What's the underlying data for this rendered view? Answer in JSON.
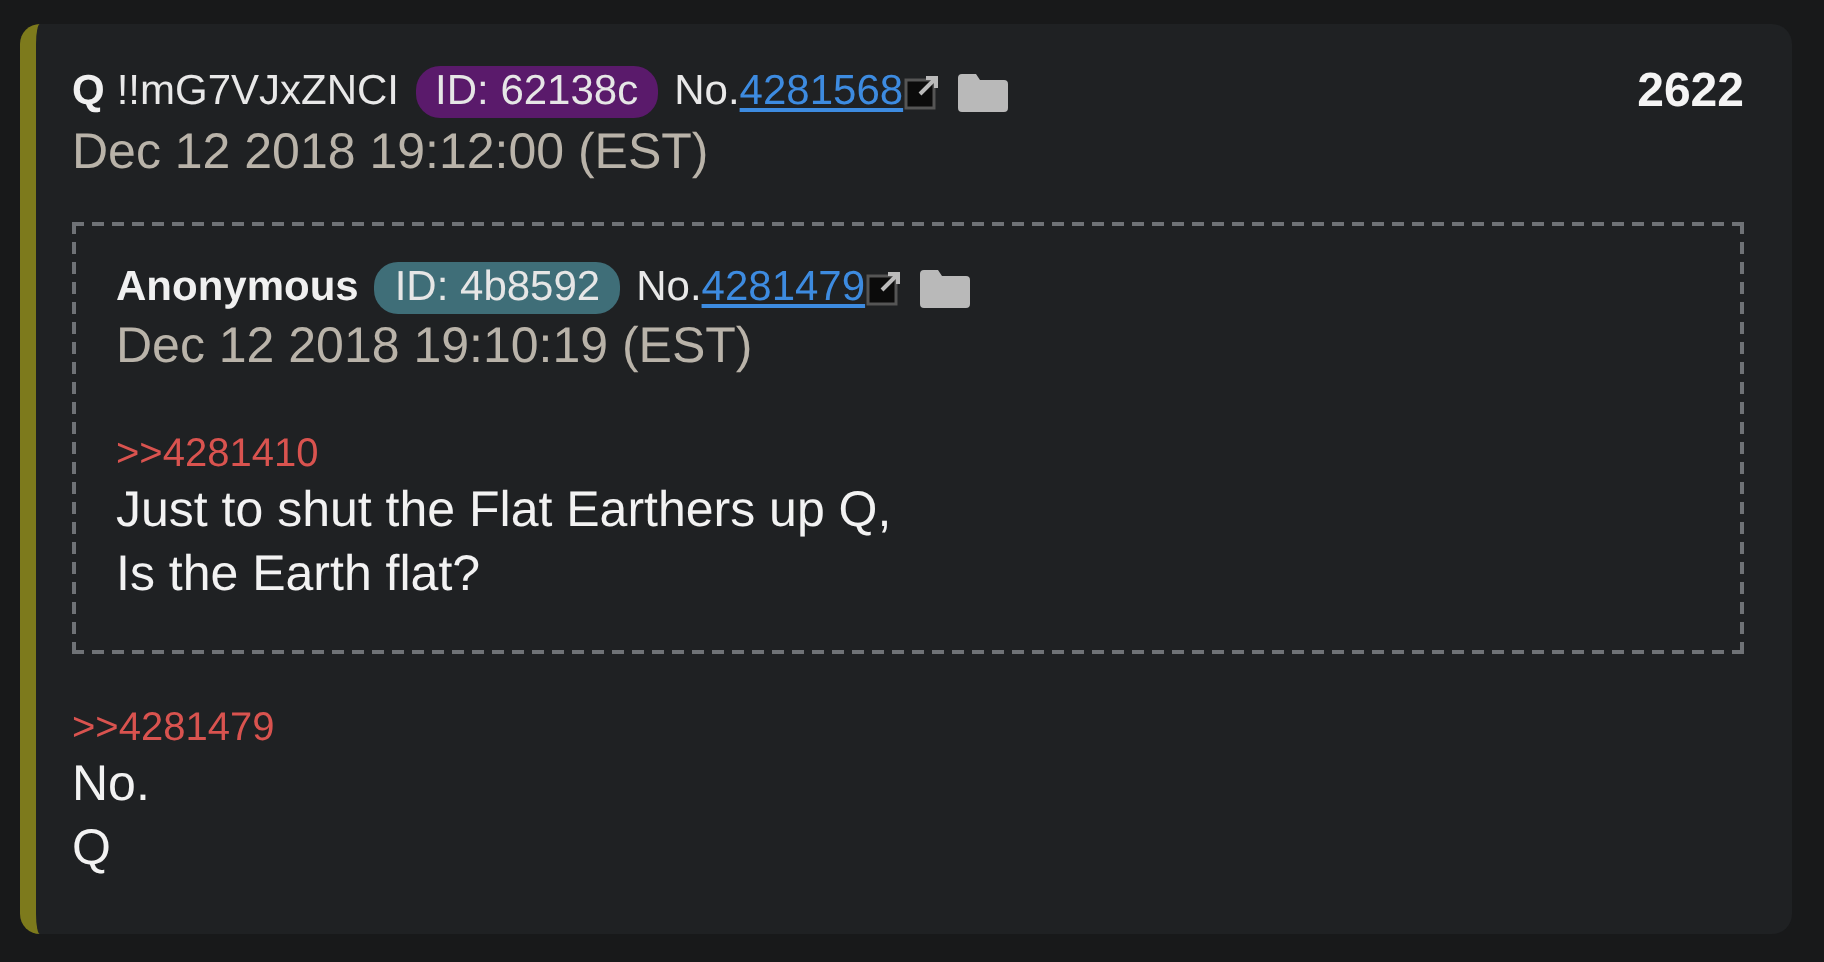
{
  "post": {
    "name": "Q",
    "tripcode": "!!mG7VJxZNCI",
    "id_badge": {
      "text": "ID: 62138c",
      "color": "#5a1a6b"
    },
    "no_label": "No.",
    "number": "4281568",
    "count": "2622",
    "date": "Dec 12 2018 19:12:00 (EST)",
    "quote": {
      "name": "Anonymous",
      "id_badge": {
        "text": "ID: 4b8592",
        "color": "#3f6e78"
      },
      "no_label": "No.",
      "number": "4281479",
      "date": "Dec 12 2018 19:10:19 (EST)",
      "reply_link": ">>4281410",
      "lines": [
        "Just to shut the Flat Earthers up Q,",
        "Is the Earth flat?"
      ]
    },
    "reply_link": ">>4281479",
    "lines": [
      "No.",
      "Q"
    ]
  }
}
